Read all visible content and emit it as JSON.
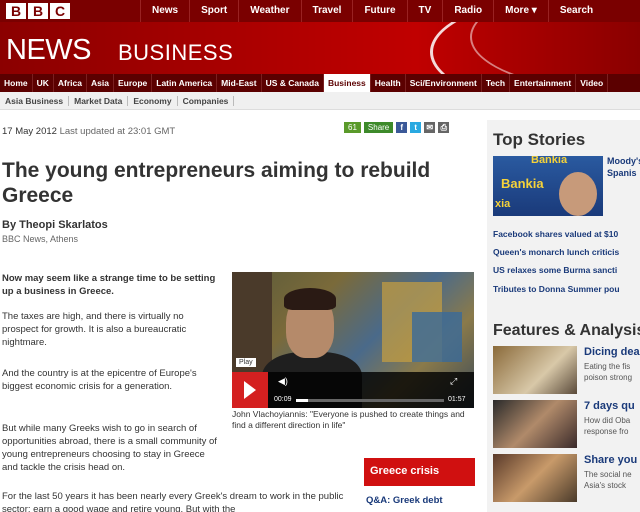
{
  "brand": {
    "letters": [
      "B",
      "B",
      "C"
    ]
  },
  "topnav": [
    "News",
    "Sport",
    "Weather",
    "Travel",
    "Future",
    "TV",
    "Radio",
    "More ▾",
    "Search"
  ],
  "banner": {
    "title": "NEWS",
    "subtitle": "BUSINESS"
  },
  "secnav": [
    "Home",
    "UK",
    "Africa",
    "Asia",
    "Europe",
    "Latin America",
    "Mid-East",
    "US & Canada",
    "Business",
    "Health",
    "Sci/Environment",
    "Tech",
    "Entertainment",
    "Video"
  ],
  "secnav_active": "Business",
  "subnav": [
    "Asia Business",
    "Market Data",
    "Economy",
    "Companies"
  ],
  "article": {
    "date": "17 May 2012",
    "updated": "Last updated at 23:01 GMT",
    "share_count": "61",
    "share_label": "Share",
    "headline": "The young entrepreneurs aiming to rebuild Greece",
    "byline": "By Theopi Skarlatos",
    "byline_sub": "BBC News, Athens",
    "para1": "Now may seem like a strange time to be setting up a business in Greece.",
    "para2": "The taxes are high, and there is virtually no prospect for growth. It is also a bureaucratic nightmare.",
    "para3": "And the country is at the epicentre of Europe's biggest economic crisis for a generation.",
    "para4": "But while many Greeks wish to go in search of opportunities abroad, there is a small community of young entrepreneurs choosing to stay in Greece and tackle the crisis head on.",
    "para5": "For the last 50 years it has been nearly every Greek's dream to work in the public sector: earn a good wage and retire young. But with the"
  },
  "video": {
    "play_label": "Play",
    "time_current": "00:09",
    "time_total": "01:57",
    "progress": 0.08,
    "caption": "John Vlachoyiannis: \"Everyone is pushed to create things and find a different direction in life\""
  },
  "crisis": {
    "title": "Greece crisis",
    "link": "Q&A: Greek debt"
  },
  "top_stories": {
    "title": "Top Stories",
    "image_text": [
      "Bankia",
      "Bankia",
      "xia"
    ],
    "caption_lines": [
      "Moody's",
      "Spanis"
    ],
    "links": [
      "Facebook shares valued at $10",
      "Queen's monarch lunch criticis",
      "US relaxes some Burma sancti",
      "Tributes to Donna Summer pou"
    ]
  },
  "features": {
    "title": "Features & Analysis",
    "items": [
      {
        "head": "Dicing dea",
        "text": [
          "Eating the fis",
          "poison strong"
        ]
      },
      {
        "head": "7 days qu",
        "text": [
          "How did Oba",
          "response fro"
        ]
      },
      {
        "head": "Share you",
        "text": [
          "The social ne",
          "Asia's stock"
        ]
      }
    ]
  },
  "colors": {
    "brand_dark": "#7a0000",
    "brand_red": "#c00000",
    "link_blue": "#1a3a7a",
    "crisis_red": "#d01010"
  }
}
